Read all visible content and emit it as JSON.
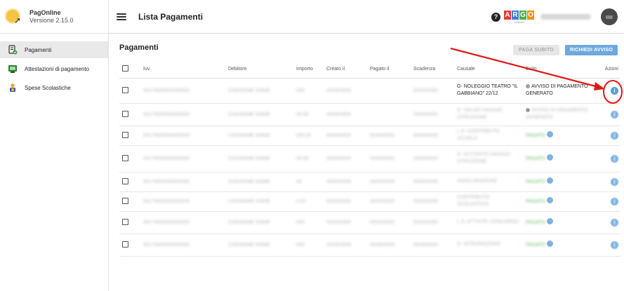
{
  "app": {
    "name": "PagOnline",
    "version": "Versione 2.15.0"
  },
  "sidebar": {
    "items": [
      {
        "label": "Pagamenti",
        "icon": "document-check-icon",
        "active": true
      },
      {
        "label": "Attestazioni di pagamento",
        "icon": "receipt-icon",
        "active": false
      },
      {
        "label": "Spese Scolastiche",
        "icon": "student-icon",
        "active": false
      }
    ]
  },
  "header": {
    "title": "Lista Pagamenti",
    "help": "?",
    "brand_letters": [
      "A",
      "R",
      "G",
      "O"
    ],
    "brand_colors": [
      "#e53935",
      "#3f7fd1",
      "#4caf50",
      "#fb8c00"
    ],
    "brand_sub": "software",
    "user_name": "UTENTE"
  },
  "main": {
    "section_title": "Pagamenti",
    "btn_pay": "PAGA SUBITO",
    "btn_request": "RICHIEDI AVVISO",
    "columns": [
      "Iuv",
      "Debitore",
      "Importo",
      "Creato il",
      "Pagato il",
      "Scadenza",
      "Causale",
      "Esito",
      "Azioni"
    ],
    "rows": [
      {
        "iuv": "00170000000000000",
        "debitore": "COGNOME NOME",
        "importo": "000",
        "creato": "00/00/0000",
        "pagato": "",
        "scadenza": "00/00/0000",
        "causale": "G- NOLEGGIO TEATRO \"IL GABBIANO\" 22/12",
        "esito": "AVVISO DI PAGAMENTO GENERATO",
        "clear": true
      },
      {
        "iuv": "00170000000000000",
        "debitore": "COGNOME NOME",
        "importo": "00,00",
        "creato": "00/00/0000",
        "pagato": "",
        "scadenza": "00/00/0000",
        "causale": "G- SALDO VIAGGIO ISTRUZIONE",
        "esito": "AVVISO DI PAGAMENTO GENERATO",
        "clear": false
      },
      {
        "iuv": "00170000000000000",
        "debitore": "COGNOME NOME",
        "importo": "000,00",
        "creato": "00/00/0000",
        "pagato": "00/00/0000",
        "scadenza": "00/00/0000",
        "causale": "L.S. CONTRIBUTO SCUOLA",
        "esito": "PAGATO",
        "clear": false
      },
      {
        "iuv": "00170000000000000",
        "debitore": "COGNOME NOME",
        "importo": "00,00",
        "creato": "00/00/0000",
        "pagato": "00/00/0000",
        "scadenza": "00/00/0000",
        "causale": "G- ACCONTO VIAGGIO ISTRUZIONE",
        "esito": "PAGATO",
        "clear": false
      },
      {
        "iuv": "00170000000000000",
        "debitore": "COGNOME NOME",
        "importo": "00",
        "creato": "00/00/0000",
        "pagato": "00/00/0000",
        "scadenza": "00/00/0000",
        "causale": "ASSICURAZIONE",
        "esito": "PAGATO",
        "clear": false
      },
      {
        "iuv": "00170000000000000",
        "debitore": "COGNOME NOME",
        "importo": "0,00",
        "creato": "00/00/0000",
        "pagato": "00/00/0000",
        "scadenza": "00/00/0000",
        "causale": "CONTRIBUTO SCOLASTICO",
        "esito": "PAGATO",
        "clear": false
      },
      {
        "iuv": "00170000000000000",
        "debitore": "COGNOME NOME",
        "importo": "000",
        "creato": "00/00/0000",
        "pagato": "00/00/0000",
        "scadenza": "00/00/0000",
        "causale": "L.S. ATTIVITA' CONCORSO",
        "esito": "PAGATO",
        "clear": false
      },
      {
        "iuv": "00170000000000000",
        "debitore": "COGNOME NOME",
        "importo": "000",
        "creato": "00/00/0000",
        "pagato": "00/00/0000",
        "scadenza": "00/00/0000",
        "causale": "G- INTEGRAZIONE",
        "esito": "PAGATO",
        "clear": false
      }
    ]
  },
  "colors": {
    "accent": "#6ea8dc",
    "annotation": "#e01818",
    "info": "#5b9bd5"
  }
}
